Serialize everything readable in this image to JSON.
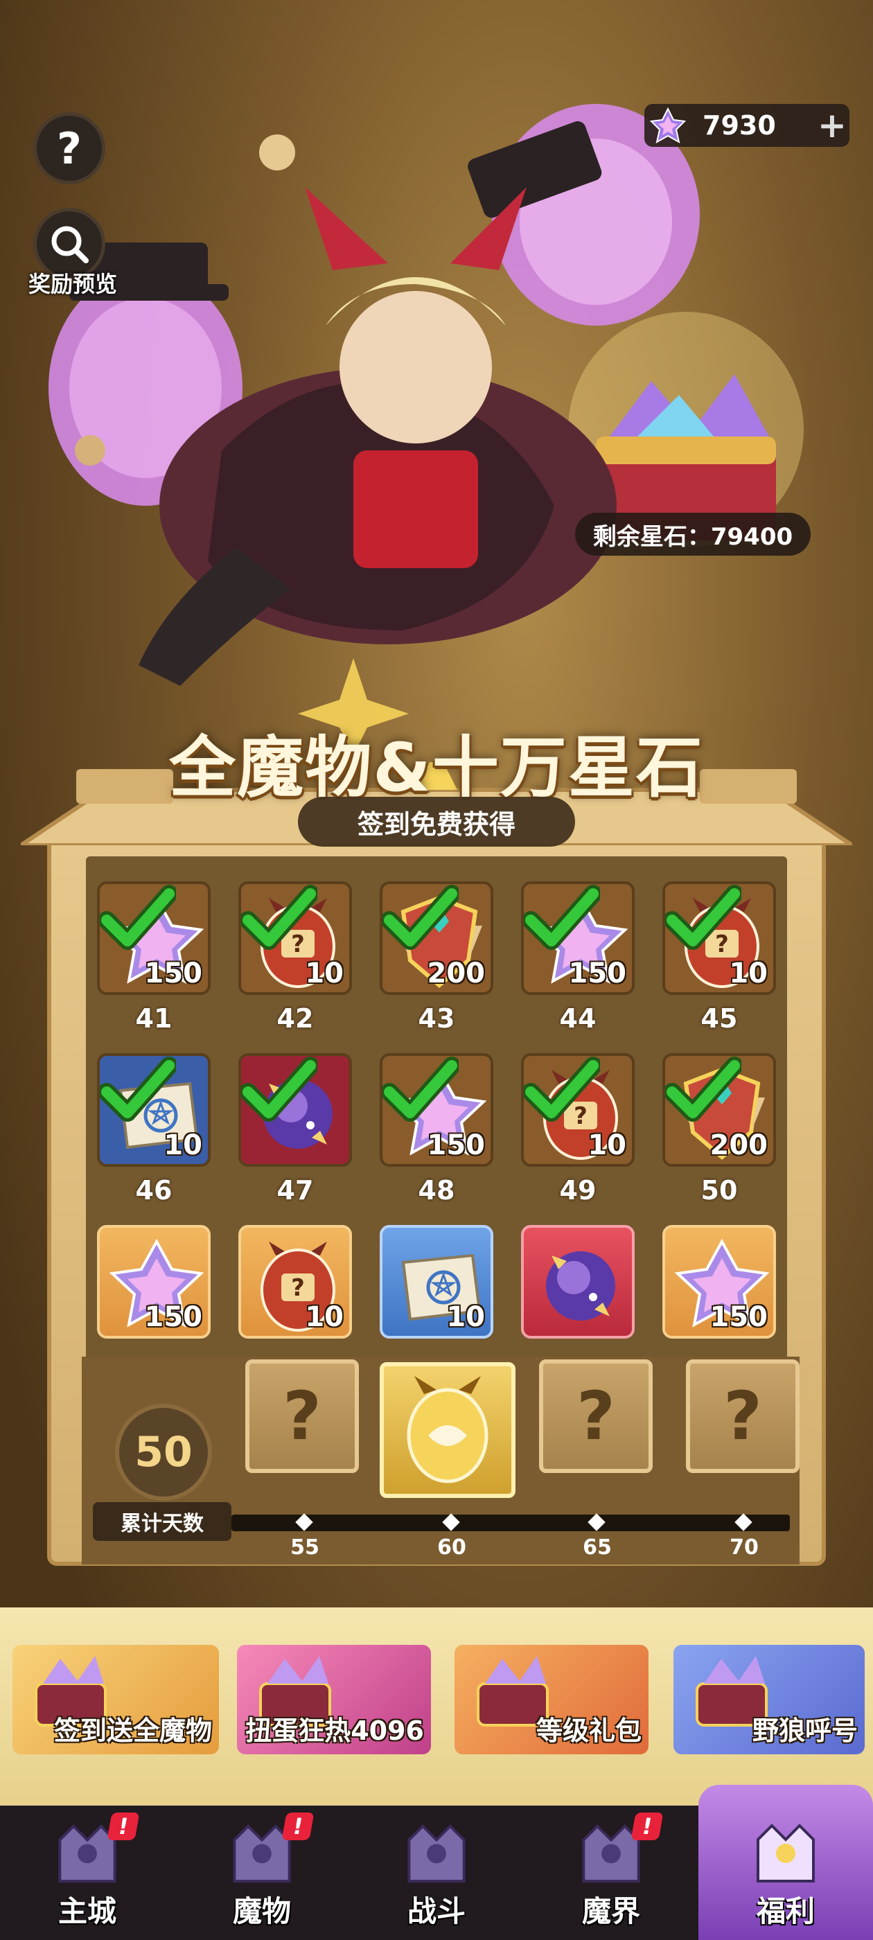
{
  "hud": {
    "help_label": "?",
    "reward_preview_label": "奖励预览",
    "star_stone_balance": "7930",
    "plus_label": "+"
  },
  "hero": {
    "remaining_label": "剩余星石：79400"
  },
  "title": {
    "main": "全魔物&十万星石",
    "sub": "签到免费获得"
  },
  "days": [
    {
      "day": "41",
      "qty": "150",
      "icon": "star-crystal-icon",
      "claimed": true,
      "style": "done"
    },
    {
      "day": "42",
      "qty": "10",
      "icon": "mystery-egg-icon",
      "claimed": true,
      "style": "done"
    },
    {
      "day": "43",
      "qty": "200",
      "icon": "crest-emblem-icon",
      "claimed": true,
      "style": "done"
    },
    {
      "day": "44",
      "qty": "150",
      "icon": "star-crystal-icon",
      "claimed": true,
      "style": "done"
    },
    {
      "day": "45",
      "qty": "10",
      "icon": "mystery-egg-icon",
      "claimed": true,
      "style": "done"
    },
    {
      "day": "46",
      "qty": "10",
      "icon": "summon-scroll-icon",
      "claimed": true,
      "style": "bluedone"
    },
    {
      "day": "47",
      "qty": "",
      "icon": "purple-orb-icon",
      "claimed": true,
      "style": "reddone"
    },
    {
      "day": "48",
      "qty": "150",
      "icon": "star-crystal-icon",
      "claimed": true,
      "style": "done"
    },
    {
      "day": "49",
      "qty": "10",
      "icon": "mystery-egg-icon",
      "claimed": true,
      "style": "done"
    },
    {
      "day": "50",
      "qty": "200",
      "icon": "crest-emblem-icon",
      "claimed": true,
      "style": "done"
    },
    {
      "day": "",
      "qty": "150",
      "icon": "star-crystal-icon",
      "claimed": false,
      "style": "orange"
    },
    {
      "day": "",
      "qty": "10",
      "icon": "mystery-egg-icon",
      "claimed": false,
      "style": "orange"
    },
    {
      "day": "",
      "qty": "10",
      "icon": "summon-scroll-icon",
      "claimed": false,
      "style": "blue"
    },
    {
      "day": "",
      "qty": "",
      "icon": "purple-orb-icon",
      "claimed": false,
      "style": "red"
    },
    {
      "day": "",
      "qty": "150",
      "icon": "star-crystal-icon",
      "claimed": false,
      "style": "orange"
    }
  ],
  "cumulative": {
    "days_count": "50",
    "label": "累计天数",
    "milestones": [
      {
        "day": "55",
        "locked": true
      },
      {
        "day": "60",
        "locked": false
      },
      {
        "day": "65",
        "locked": true
      },
      {
        "day": "70",
        "locked": true
      }
    ],
    "lock_glyph": "?"
  },
  "events": [
    {
      "label": "签到送全魔物"
    },
    {
      "label": "扭蛋狂热4096"
    },
    {
      "label": "等级礼包"
    },
    {
      "label": "野狼呼号"
    }
  ],
  "nav": [
    {
      "label": "主城",
      "badge": "!",
      "active": false
    },
    {
      "label": "魔物",
      "badge": "!",
      "active": false
    },
    {
      "label": "战斗",
      "badge": "",
      "active": false
    },
    {
      "label": "魔界",
      "badge": "!",
      "active": false
    },
    {
      "label": "福利",
      "badge": "",
      "active": true
    }
  ],
  "colors": {
    "accent_purple": "#9a5ad0",
    "check_green": "#34c83a",
    "badge_red": "#e8223a",
    "gold": "#f3d36d"
  }
}
